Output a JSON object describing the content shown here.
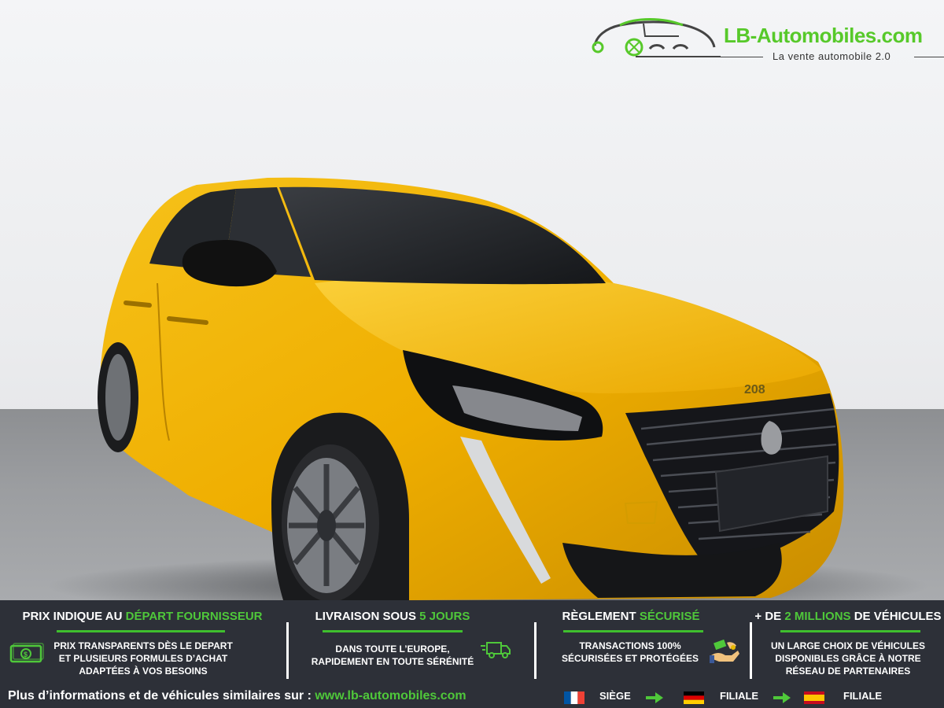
{
  "logo": {
    "name": "LB-Automobiles.com",
    "slogan": "La vente automobile 2.0",
    "icon": "car-logo-icon",
    "brand_color": "#57c92a"
  },
  "car": {
    "badge": "208",
    "body_color": "#f2b400"
  },
  "features": [
    {
      "title_pre": "PRIX INDIQUE AU ",
      "title_hl": "DÉPART FOURNISSEUR",
      "title_post": "",
      "lines": [
        "PRIX TRANSPARENTS DÈS LE DEPART",
        "ET PLUSIEURS FORMULES D’ACHAT",
        "ADAPTÉES À VOS BESOINS"
      ],
      "icon": "money-icon"
    },
    {
      "title_pre": "LIVRAISON SOUS ",
      "title_hl": "5 JOURS",
      "title_post": "",
      "lines": [
        "DANS TOUTE L’EUROPE,",
        "RAPIDEMENT EN TOUTE SÉRÉNITÉ"
      ],
      "icon": "delivery-truck-icon"
    },
    {
      "title_pre": "RÈGLEMENT ",
      "title_hl": "SÉCURISÉ",
      "title_post": "",
      "lines": [
        "TRANSACTIONS 100%",
        "SÉCURISÉES ET PROTÉGÉES"
      ],
      "icon": "payment-hands-icon"
    },
    {
      "title_pre": "+ DE ",
      "title_hl": "2 MILLIONS",
      "title_post": " DE VÉHICULES",
      "lines": [
        "UN LARGE CHOIX DE VÉHICULES",
        "DISPONIBLES GRÂCE À NOTRE",
        "RÉSEAU DE PARTENAIRES"
      ],
      "icon": ""
    }
  ],
  "bottom": {
    "more_text": "Plus d’informations et de véhicules similaires sur : ",
    "url": "www.lb-automobiles.com",
    "locations": [
      {
        "flag": "france-flag-icon",
        "label": "SIÈGE"
      },
      {
        "flag": "germany-flag-icon",
        "label": "FILIALE"
      },
      {
        "flag": "spain-flag-icon",
        "label": "FILIALE"
      }
    ]
  },
  "colors": {
    "banner_bg": "#2d3038",
    "accent": "#4fc83a"
  }
}
